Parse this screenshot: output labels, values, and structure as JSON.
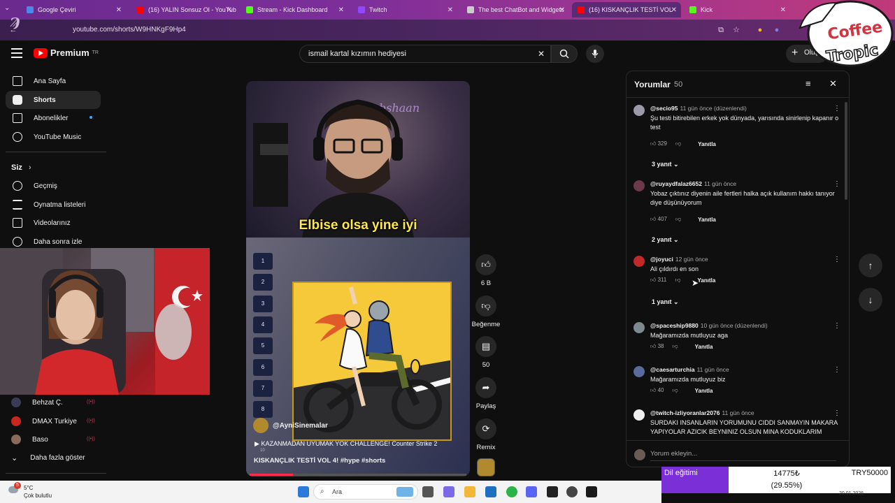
{
  "browser": {
    "tabs": [
      {
        "title": "Google Çeviri",
        "fav": "#4a88ea"
      },
      {
        "title": "(16) YALIN Sonsuz Ol - YouTube",
        "fav": "#ff0000"
      },
      {
        "title": "Stream - Kick Dashboard",
        "fav": "#53fc18"
      },
      {
        "title": "Twitch",
        "fav": "#9147ff"
      },
      {
        "title": "The best ChatBot and Widgets",
        "fav": "#cccccc"
      },
      {
        "title": "(16) KISKANÇLIK TESTİ VOL",
        "fav": "#ff0000"
      },
      {
        "title": "Kick",
        "fav": "#53fc18"
      }
    ],
    "url": "youtube.com/shorts/W9HNKgF9Hp4"
  },
  "youtube": {
    "brand": "Premium",
    "region": "TR",
    "search_query": "ismail kartal kızımın hediyesi",
    "create_label": "Oluştur"
  },
  "sidebar": {
    "items": [
      {
        "label": "Ana Sayfa",
        "icon": "home-icon"
      },
      {
        "label": "Shorts",
        "icon": "shorts-icon"
      },
      {
        "label": "Abonelikler",
        "icon": "subscriptions-icon"
      },
      {
        "label": "YouTube Music",
        "icon": "music-icon"
      }
    ],
    "you_header": "Siz",
    "you_items": [
      {
        "label": "Geçmiş",
        "icon": "history-icon"
      },
      {
        "label": "Oynatma listeleri",
        "icon": "playlist-icon"
      },
      {
        "label": "Videolarınız",
        "icon": "video-icon"
      },
      {
        "label": "Daha sonra izle",
        "icon": "clock-icon"
      }
    ],
    "subscriptions": [
      {
        "label": "Behzat Ç.",
        "color": "#3b3b55"
      },
      {
        "label": "DMAX Turkiye",
        "color": "#c8271f"
      },
      {
        "label": "Baso",
        "color": "#8a6a5a"
      }
    ],
    "show_more": "Daha fazla göster"
  },
  "short": {
    "caption": "Elbise olsa yine iyi",
    "numbers": [
      "1",
      "2",
      "3",
      "4",
      "5",
      "6",
      "7",
      "8"
    ],
    "channel": "@AyniSinemalar",
    "music": "KAZANMADAN UYUMAK YOK CHALLENGE! Counter Strike 2",
    "music_sub": "10",
    "title": "KISKANÇLIK TESTİ VOL 4! #hype #shorts",
    "progress": 0.2
  },
  "actions": {
    "likes": "6 B",
    "dislike": "Beğenme",
    "comments": "50",
    "share": "Paylaş",
    "remix": "Remix"
  },
  "comments_panel": {
    "title": "Yorumlar",
    "count": "50",
    "reply_label": "Yanıtla",
    "input_placeholder": "Yorum ekleyin...",
    "items": [
      {
        "user": "@secio95",
        "time": "11 gün önce (düzenlendi)",
        "text": "Şu testi bitirebilen erkek yok dünyada, yarısında sinirlenip kapanır o test",
        "likes": "329",
        "replies": "3 yanıt",
        "color": "#9a9aa8"
      },
      {
        "user": "@ruyaydfalaz6652",
        "time": "11 gün önce",
        "text": "Yobaz çıktınız diyenin aile fertleri halka açık kullanım hakkı tanıyor diye düşünüyorum",
        "likes": "407",
        "replies": "2 yanıt",
        "color": "#6b3a4a"
      },
      {
        "user": "@joyuci",
        "time": "12 gün önce",
        "text": "Ali çıldırdı en son",
        "likes": "311",
        "replies": "1 yanıt",
        "color": "#c0282a"
      },
      {
        "user": "@spaceship9880",
        "time": "10 gün önce (düzenlendi)",
        "text": "Mağaramızda mutluyuz aga",
        "likes": "38",
        "replies": "",
        "color": "#7c8a90"
      },
      {
        "user": "@caesarturchia",
        "time": "11 gün önce",
        "text": "Mağaramızda mutluyuz biz",
        "likes": "40",
        "replies": "",
        "color": "#5a6a9a"
      },
      {
        "user": "@twitch-izliyoranlar2076",
        "time": "11 gün önce",
        "text": "SURDAKI INSANLARIN YORUMUNU CIDDI SANMAYIN MAKARA YAPIYOLAR AZICIK BEYNINIZ OLSUN MINA KODUKLARIM",
        "likes": "",
        "replies": "",
        "color": "#eeeeee"
      }
    ]
  },
  "overlay": {
    "logo_line1": "Coffee",
    "logo_line2": "Tropic",
    "donation_label": "Dil eğitimi",
    "donation_amount": "14775₺",
    "donation_percent": "(29.55%)",
    "donation_goal": "TRY50000"
  },
  "taskbar": {
    "temperature": "5°C",
    "condition": "Çok bulutlu",
    "badge": "5",
    "search": "Ara",
    "date": "20.01.2026"
  }
}
